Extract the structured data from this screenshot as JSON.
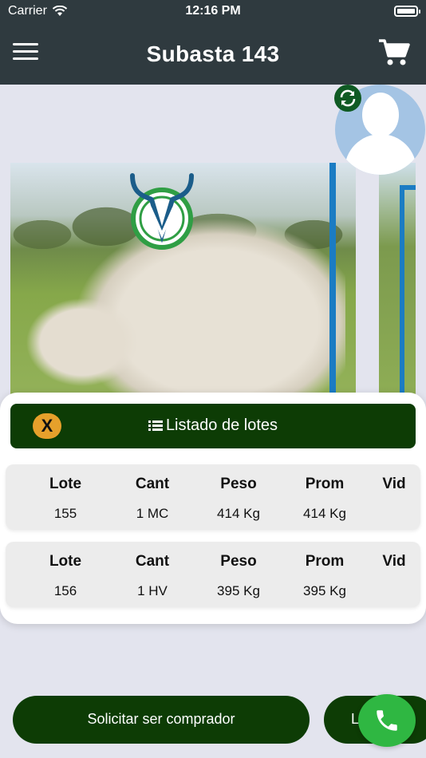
{
  "status_bar": {
    "carrier": "Carrier",
    "time": "12:16 PM"
  },
  "header": {
    "title": "Subasta 143",
    "menu_icon": "hamburger-menu-icon",
    "cart_icon": "shopping-cart-icon"
  },
  "colors": {
    "header_bg": "#2f3a3f",
    "primary_green": "#0d3c05",
    "accent_orange": "#e6a02b",
    "call_green": "#2fb742",
    "stripe_blue": "#1b7cc3"
  },
  "lots_panel": {
    "close_label": "X",
    "title": "Listado de lotes",
    "columns": [
      "Lote",
      "Cant",
      "Peso",
      "Prom",
      "Vid"
    ],
    "rows": [
      {
        "lote": "155",
        "cant": "1 MC",
        "peso": "414 Kg",
        "prom": "414 Kg",
        "vid": ""
      },
      {
        "lote": "156",
        "cant": "1 HV",
        "peso": "395 Kg",
        "prom": "395 Kg",
        "vid": ""
      }
    ]
  },
  "actions": {
    "request_buyer": "Solicitar ser comprador",
    "second_label": "L"
  }
}
